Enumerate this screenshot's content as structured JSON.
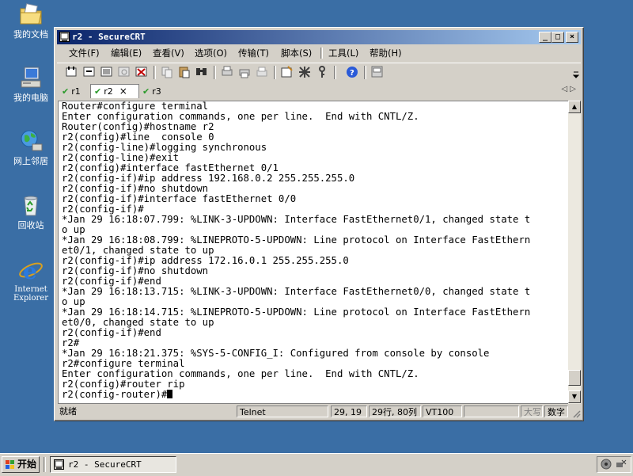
{
  "desktop": {
    "icons": [
      {
        "label": "我的文档"
      },
      {
        "label": "我的电脑"
      },
      {
        "label": "网上邻居"
      },
      {
        "label": "回收站"
      },
      {
        "label": "Internet Explorer"
      }
    ]
  },
  "window": {
    "title": "r2 - SecureCRT",
    "controls": {
      "minimize": "_",
      "maximize": "□",
      "close": "×"
    },
    "menu": [
      "文件(F)",
      "编辑(E)",
      "查看(V)",
      "选项(O)",
      "传输(T)",
      "脚本(S)",
      "工具(L)",
      "帮助(H)"
    ],
    "tabs": [
      {
        "label": "r1",
        "active": false
      },
      {
        "label": "r2",
        "active": true,
        "close": "×"
      },
      {
        "label": "r3",
        "active": false
      }
    ],
    "tab_arrows": "◁ ▷",
    "terminal_lines": [
      "Router#configure terminal",
      "Enter configuration commands, one per line.  End with CNTL/Z.",
      "Router(config)#hostname r2",
      "r2(config)#line  console 0",
      "r2(config-line)#logging synchronous",
      "r2(config-line)#exit",
      "r2(config)#interface fastEthernet 0/1",
      "r2(config-if)#ip address 192.168.0.2 255.255.255.0",
      "r2(config-if)#no shutdown",
      "r2(config-if)#interface fastEthernet 0/0",
      "r2(config-if)#",
      "*Jan 29 16:18:07.799: %LINK-3-UPDOWN: Interface FastEthernet0/1, changed state t",
      "o up",
      "*Jan 29 16:18:08.799: %LINEPROTO-5-UPDOWN: Line protocol on Interface FastEthern",
      "et0/1, changed state to up",
      "r2(config-if)#ip address 172.16.0.1 255.255.255.0",
      "r2(config-if)#no shutdown",
      "r2(config-if)#end",
      "*Jan 29 16:18:13.715: %LINK-3-UPDOWN: Interface FastEthernet0/0, changed state t",
      "o up",
      "*Jan 29 16:18:14.715: %LINEPROTO-5-UPDOWN: Line protocol on Interface FastEthern",
      "et0/0, changed state to up",
      "r2(config-if)#end",
      "r2#",
      "*Jan 29 16:18:21.375: %SYS-5-CONFIG_I: Configured from console by console",
      "r2#configure terminal",
      "Enter configuration commands, one per line.  End with CNTL/Z.",
      "r2(config)#router rip"
    ],
    "prompt": "r2(config-router)#",
    "status": {
      "ready": "就绪",
      "protocol": "Telnet",
      "cursor_pos": "29, 19",
      "size": "29行, 80列",
      "emulation": "VT100",
      "caps": "大写",
      "num": "数字"
    }
  },
  "taskbar": {
    "start_label": "开始",
    "task_label": "r2 - SecureCRT"
  },
  "colors": {
    "desktop": "#3a6ea5",
    "title_start": "#0a246a",
    "title_end": "#a6caf0",
    "chrome": "#d4d0c8"
  }
}
